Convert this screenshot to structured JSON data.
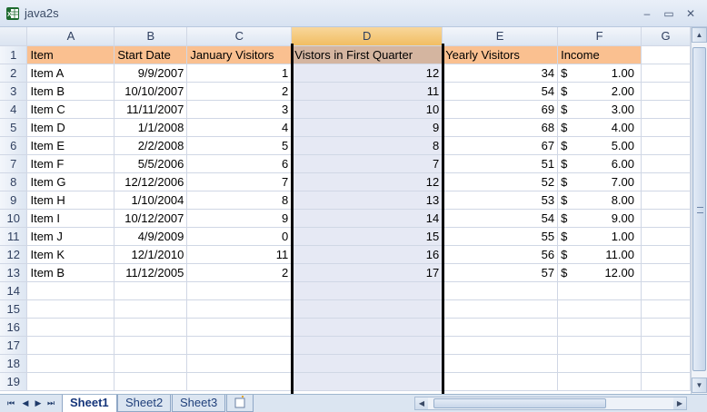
{
  "window": {
    "title": "java2s"
  },
  "columns": [
    "A",
    "B",
    "C",
    "D",
    "E",
    "F",
    "G"
  ],
  "selected_column": "D",
  "header_row": {
    "row_num": "1",
    "item": "Item",
    "start_date": "Start Date",
    "january_visitors": "January Visitors",
    "first_quarter": "Vistors in First Quarter",
    "yearly_visitors": "Yearly Visitors",
    "income": "Income"
  },
  "rows": [
    {
      "row_num": "2",
      "item": "Item A",
      "start_date": "9/9/2007",
      "jan": "1",
      "q1": "12",
      "yearly": "34",
      "cur": "$",
      "income": "1.00"
    },
    {
      "row_num": "3",
      "item": "Item B",
      "start_date": "10/10/2007",
      "jan": "2",
      "q1": "11",
      "yearly": "54",
      "cur": "$",
      "income": "2.00"
    },
    {
      "row_num": "4",
      "item": "Item C",
      "start_date": "11/11/2007",
      "jan": "3",
      "q1": "10",
      "yearly": "69",
      "cur": "$",
      "income": "3.00"
    },
    {
      "row_num": "5",
      "item": "Item D",
      "start_date": "1/1/2008",
      "jan": "4",
      "q1": "9",
      "yearly": "68",
      "cur": "$",
      "income": "4.00"
    },
    {
      "row_num": "6",
      "item": "Item E",
      "start_date": "2/2/2008",
      "jan": "5",
      "q1": "8",
      "yearly": "67",
      "cur": "$",
      "income": "5.00"
    },
    {
      "row_num": "7",
      "item": "Item F",
      "start_date": "5/5/2006",
      "jan": "6",
      "q1": "7",
      "yearly": "51",
      "cur": "$",
      "income": "6.00"
    },
    {
      "row_num": "8",
      "item": "Item G",
      "start_date": "12/12/2006",
      "jan": "7",
      "q1": "12",
      "yearly": "52",
      "cur": "$",
      "income": "7.00"
    },
    {
      "row_num": "9",
      "item": "Item H",
      "start_date": "1/10/2004",
      "jan": "8",
      "q1": "13",
      "yearly": "53",
      "cur": "$",
      "income": "8.00"
    },
    {
      "row_num": "10",
      "item": "Item I",
      "start_date": "10/12/2007",
      "jan": "9",
      "q1": "14",
      "yearly": "54",
      "cur": "$",
      "income": "9.00"
    },
    {
      "row_num": "11",
      "item": "Item J",
      "start_date": "4/9/2009",
      "jan": "0",
      "q1": "15",
      "yearly": "55",
      "cur": "$",
      "income": "1.00"
    },
    {
      "row_num": "12",
      "item": "Item K",
      "start_date": "12/1/2010",
      "jan": "11",
      "q1": "16",
      "yearly": "56",
      "cur": "$",
      "income": "11.00"
    },
    {
      "row_num": "13",
      "item": "Item B",
      "start_date": "11/12/2005",
      "jan": "2",
      "q1": "17",
      "yearly": "57",
      "cur": "$",
      "income": "12.00"
    }
  ],
  "empty_rows": [
    "14",
    "15",
    "16",
    "17",
    "18",
    "19"
  ],
  "sheet_tabs": [
    "Sheet1",
    "Sheet2",
    "Sheet3"
  ],
  "active_sheet": "Sheet1",
  "colors": {
    "header_fill": "#fac090",
    "selection_fill": "#e6e9f4",
    "grid_line": "#d0d7e5"
  }
}
